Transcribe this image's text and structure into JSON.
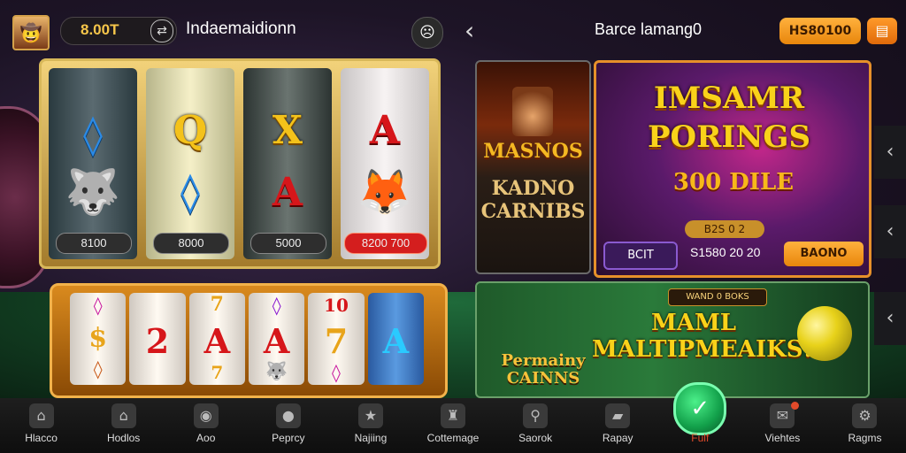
{
  "left_header": {
    "balance": "8.00T",
    "title": "Indaemaidionn"
  },
  "right_header": {
    "title": "Barce lamang0",
    "coins_button": "HS80100"
  },
  "slot_machine_1": {
    "reels": [
      {
        "symbols": [
          "◊",
          "🐺"
        ],
        "label": "8100"
      },
      {
        "symbols": [
          "Q",
          "◊"
        ],
        "label": "8000"
      },
      {
        "symbols": [
          "X",
          "A"
        ],
        "label": "5000"
      },
      {
        "symbols": [
          "A",
          "🦊"
        ],
        "label": "8200 700"
      }
    ]
  },
  "slot_machine_2": {
    "columns": [
      {
        "top": "◊",
        "mid": "$",
        "bot": "◊"
      },
      {
        "top": "",
        "mid": "2",
        "bot": ""
      },
      {
        "top": "7",
        "mid": "A",
        "bot": "7"
      },
      {
        "top": "◊",
        "mid": "A",
        "bot": "🐺"
      },
      {
        "top": "10",
        "mid": "7",
        "bot": "◊"
      },
      {
        "top": "",
        "mid": "A",
        "bot": ""
      }
    ]
  },
  "promo_left": {
    "title": "MASNOS",
    "subtitle": "KADNO CARNIBS"
  },
  "promo_main": {
    "title": "IMSAMR PORINGS",
    "amount": "300 DILE",
    "chip": "B2S 0 2",
    "bet_button": "BCIT",
    "bet_amount": "S1580 20 20",
    "action_button": "BAONO"
  },
  "banner": {
    "badge": "WAND 0 BOKS",
    "title": "MAML MALTIPMEAIKS!",
    "left_title": "Permainy CAINNS"
  },
  "bottom_nav": [
    {
      "label": "Hlacco",
      "icon": "home-icon"
    },
    {
      "label": "Hodlos",
      "icon": "house-icon"
    },
    {
      "label": "Aoo",
      "icon": "eye-icon"
    },
    {
      "label": "Peprcy",
      "icon": "coin-icon"
    },
    {
      "label": "Najiing",
      "icon": "star-icon"
    },
    {
      "label": "Cottemage",
      "icon": "crown-icon"
    },
    {
      "label": "Saorok",
      "icon": "search-icon"
    },
    {
      "label": "Rapay",
      "icon": "card-icon"
    },
    {
      "label": "Fulf",
      "icon": "check-icon",
      "active": true
    },
    {
      "label": "Viehtes",
      "icon": "chat-icon"
    },
    {
      "label": "Ragms",
      "icon": "gear-icon"
    }
  ],
  "colors": {
    "accent_orange": "#e8860c",
    "gold": "#f4c21a",
    "active_green": "#12a04a",
    "active_label": "#e14a2a"
  }
}
